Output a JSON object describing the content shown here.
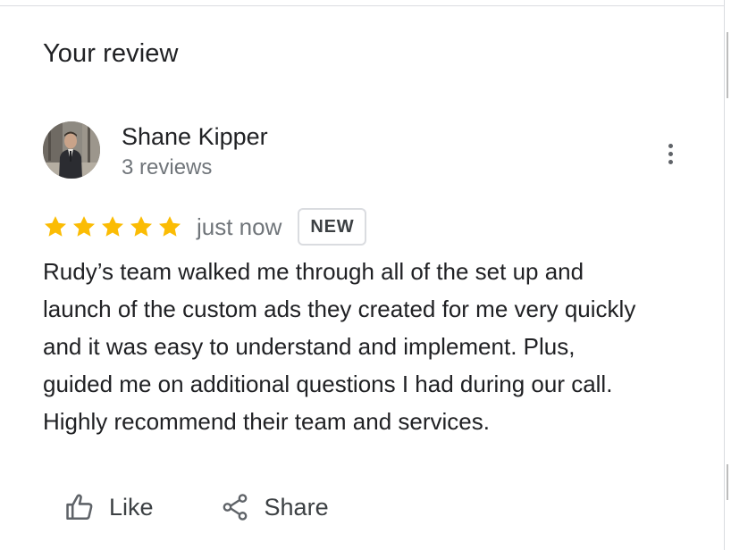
{
  "section": {
    "title": "Your review"
  },
  "author": {
    "name": "Shane Kipper",
    "meta": "3 reviews",
    "avatar_icon": "user-photo-avatar"
  },
  "menu": {
    "icon": "more-vert-icon"
  },
  "rating": {
    "stars": 5,
    "max_stars": 5,
    "star_color": "#fbbc04",
    "time": "just now",
    "badge": "NEW"
  },
  "review": {
    "lines": [
      "Rudy’s team walked me through all of the set up and",
      "launch of the custom ads they created for me very quickly",
      "and it was easy to understand and implement. Plus,",
      "guided me on additional questions I had during our call.",
      "Highly recommend their team and services."
    ]
  },
  "actions": {
    "like_label": "Like",
    "like_icon": "thumb-up-outline-icon",
    "share_label": "Share",
    "share_icon": "share-icon"
  },
  "colors": {
    "text_primary": "#202124",
    "text_secondary": "#70757a",
    "divider": "#dadce0",
    "icon": "#5f6368"
  }
}
